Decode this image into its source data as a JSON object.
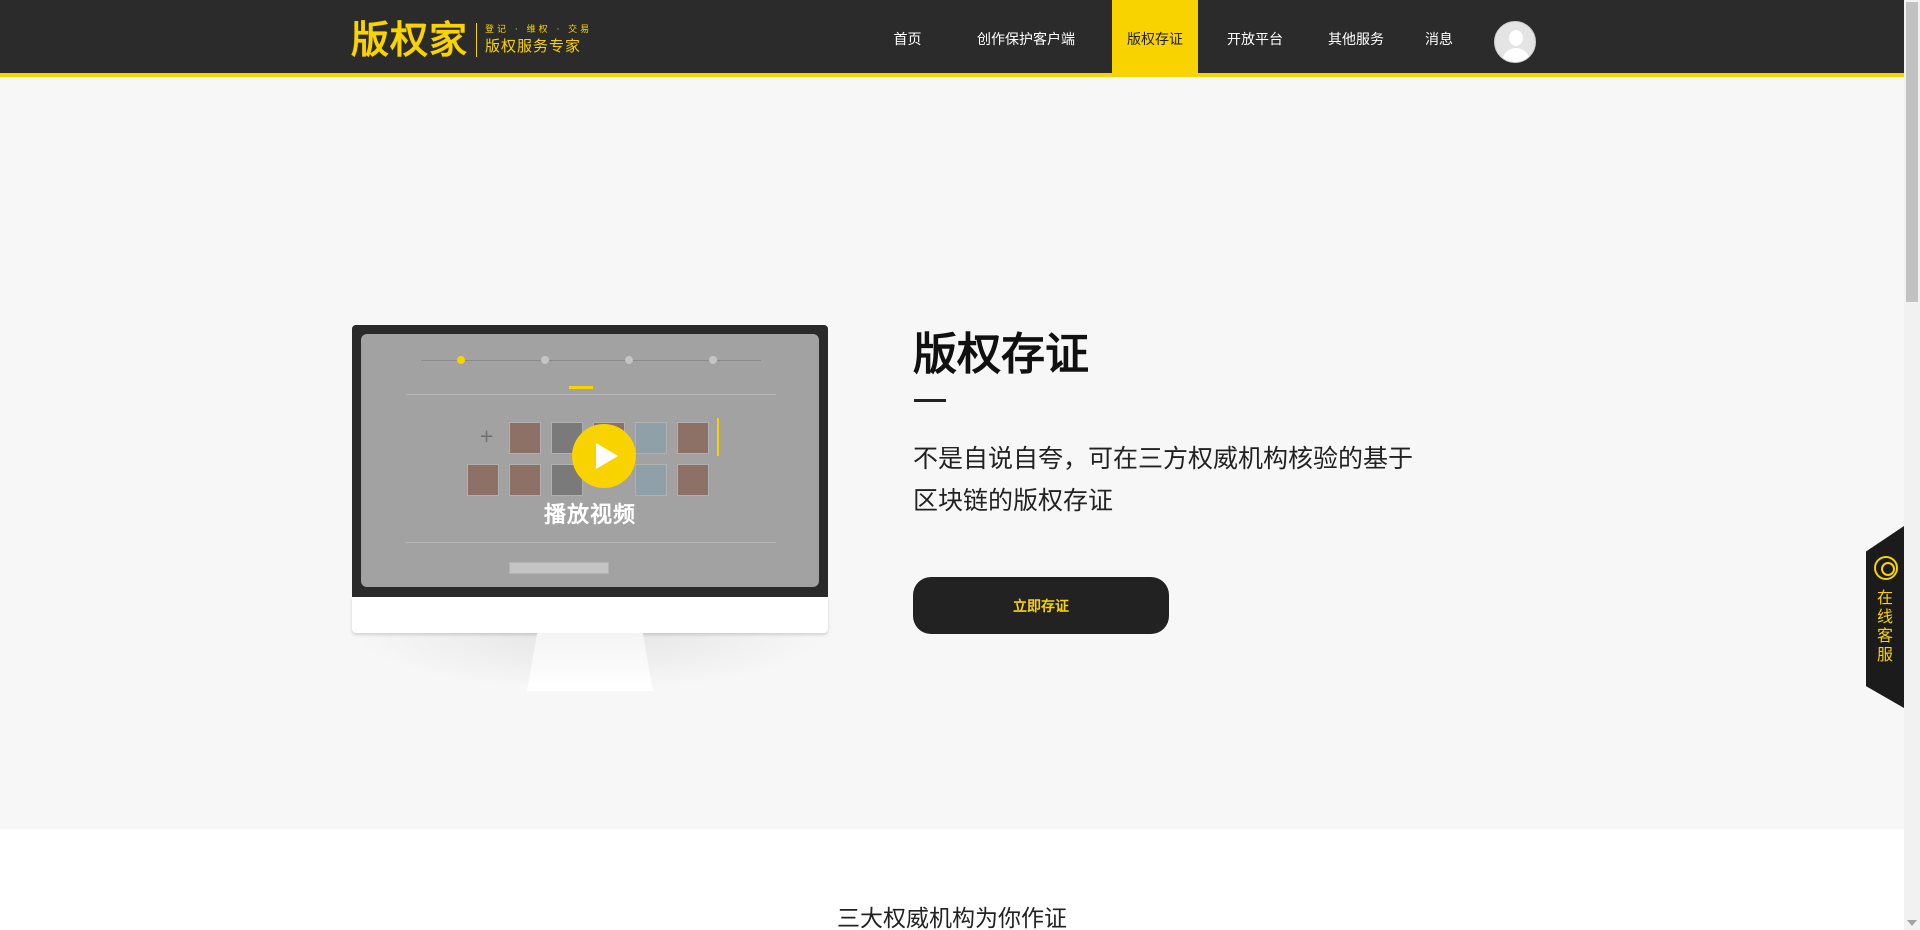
{
  "header": {
    "logo_main": "版权家",
    "logo_tagline": "登记 · 维权 · 交易",
    "logo_subtitle": "版权服务专家",
    "nav": [
      {
        "label": "首页",
        "active": false
      },
      {
        "label": "创作保护客户端",
        "active": false
      },
      {
        "label": "版权存证",
        "active": true
      },
      {
        "label": "开放平台",
        "active": false
      },
      {
        "label": "其他服务",
        "active": false
      },
      {
        "label": "消息",
        "active": false
      }
    ],
    "avatar_icon": "user-avatar-icon"
  },
  "hero": {
    "title": "版权存证",
    "description": "不是自说自夸，可在三方权威机构核验的基于区块链的版权存证",
    "cta_label": "立即存证",
    "video_label": "播放视频",
    "play_icon": "play-icon"
  },
  "section2": {
    "title": "三大权威机构为你作证"
  },
  "float_service": {
    "label": "在线客服",
    "icon": "headset-icon"
  },
  "colors": {
    "accent": "#f9d300",
    "header_bg": "#2b2b2b",
    "hero_bg": "#f7f7f7",
    "button_bg": "#222222"
  }
}
